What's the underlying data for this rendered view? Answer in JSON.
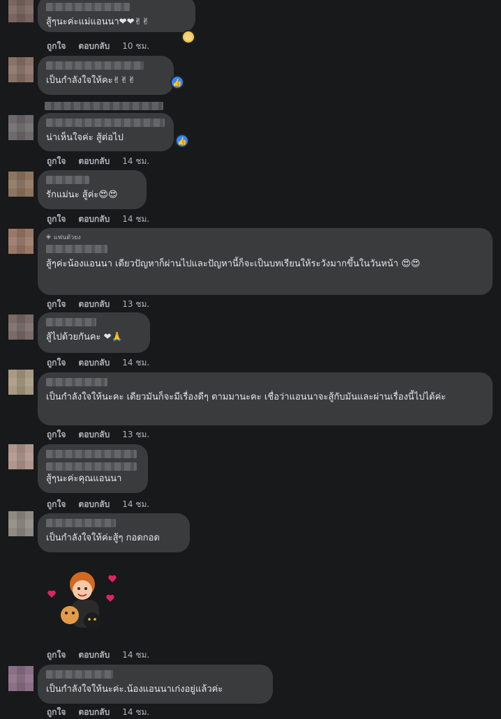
{
  "actions": {
    "like": "ถูกใจ",
    "reply": "ตอบกลับ"
  },
  "comments": [
    {
      "text": "สู้ๆนะค่ะแม่แอนนา❤❤✌✌",
      "time": "10 ชม."
    },
    {
      "text": "เป็นกำลังใจให้คะ✌✌✌",
      "time": ""
    },
    {
      "text": "น่าเห็นใจค่ะ สู้ต่อไป",
      "time": "14 ชม."
    },
    {
      "text": "รักแม่นะ สู้ค่ะ😍😍",
      "time": "14 ชม."
    },
    {
      "badge": "แฟนตัวยง",
      "text": "สู้ๆค่ะน้องแอนนา เดียวปัญหาก็ผ่านไปและปัญหานี้ก็จะเป็นบทเรียนให้ระวังมากขึ้นในวันหน้า 😍😍",
      "time": "13 ชม."
    },
    {
      "text": "สู้ไปด้วยกันคะ ❤🙏",
      "time": "14 ชม."
    },
    {
      "text": "เป็นกำลังใจให้นะคะ เดียวมันก็จะมีเรื่องดีๆ ตามมานะคะ เชื่อว่าแอนนาจะสู้กับมันและผ่านเรื่องนี้ไปได้ค่ะ",
      "time": "13 ชม."
    },
    {
      "text": "สู้ๆนะค่ะคุณแอนนา",
      "time": "14 ชม."
    },
    {
      "text": "เป็นกำลังใจให้ค่ะสู้ๆ กอดกอด",
      "time": ""
    },
    {
      "sticker": "avatar-sticker-with-cats",
      "time": "14 ชม."
    },
    {
      "text": "เป็นกำลังใจให้นะค่ะ.น้องแอนนาเก่งอยู่แล้วค่ะ",
      "time": "14 ชม."
    }
  ],
  "colors": {
    "background": "#18191a",
    "bubble": "#3a3b3c",
    "text": "#e4e6eb",
    "secondary": "#b0b3b8",
    "like_blue": "#2d88ff"
  }
}
